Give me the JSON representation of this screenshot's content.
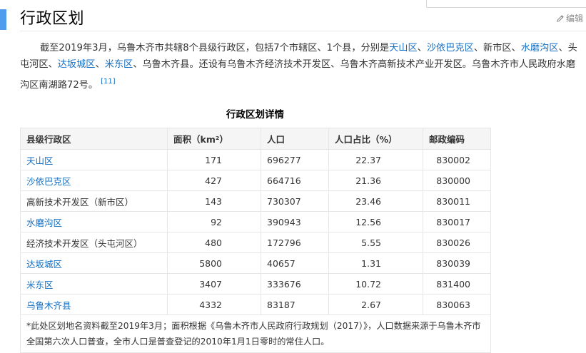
{
  "section": {
    "heading": "行政区划",
    "edit_label": "编辑",
    "edit_icon": "pencil-icon"
  },
  "paragraph": {
    "lead": "截至2019年3月，乌鲁木齐市共辖8个县级行政区，包括7个市辖区、1个县，分别是",
    "link_tianshan": "天山区",
    "sep1": "、",
    "link_shayibake": "沙依巴克区",
    "mid1": "、新市区、",
    "link_shuimogou": "水磨沟区",
    "mid2": "、头屯河区、",
    "link_dabancheng": "达坂城区",
    "sep2": "、",
    "link_midong": "米东区",
    "tail": "、乌鲁木齐县。还设有乌鲁木齐经济技术开发区、乌鲁木齐高新技术产业开发区。乌鲁木齐市人民政府水磨沟区南湖路72号。",
    "citation": "[11]"
  },
  "table": {
    "caption": "行政区划详情",
    "headers": [
      "县级行政区",
      "面积（km²）",
      "人口",
      "人口占比（%）",
      "邮政编码"
    ],
    "rows": [
      {
        "name": "天山区",
        "link": true,
        "area": "171",
        "population": "696277",
        "share": "22.37",
        "postcode": "830002"
      },
      {
        "name": "沙依巴克区",
        "link": true,
        "area": "427",
        "population": "664716",
        "share": "21.36",
        "postcode": "830000"
      },
      {
        "name": "高新技术开发区（新市区）",
        "link": false,
        "area": "143",
        "population": "730307",
        "share": "23.46",
        "postcode": "830011"
      },
      {
        "name": "水磨沟区",
        "link": true,
        "area": "92",
        "population": "390943",
        "share": "12.56",
        "postcode": "830017"
      },
      {
        "name": "经济技术开发区（头屯河区）",
        "link": false,
        "area": "480",
        "population": "172796",
        "share": "5.55",
        "postcode": "830026"
      },
      {
        "name": "达坂城区",
        "link": true,
        "area": "5800",
        "population": "40657",
        "share": "1.31",
        "postcode": "830039"
      },
      {
        "name": "米东区",
        "link": true,
        "area": "3407",
        "population": "333676",
        "share": "10.72",
        "postcode": "831400"
      },
      {
        "name": "乌鲁木齐县",
        "link": true,
        "area": "4332",
        "population": "83187",
        "share": "2.67",
        "postcode": "830063"
      }
    ],
    "note": "*此处区划地名资料截至2019年3月；面积根据《乌鲁木齐市人民政府行政规划（2017）》，人口数据来源于乌鲁木齐市全国第六次人口普查，全市人口是普查登记的2010年1月1日零时的常住人口。"
  },
  "colors": {
    "accent_bar": "#4f9cee",
    "link": "#136ec2",
    "header_bg": "#f5f5f5"
  }
}
